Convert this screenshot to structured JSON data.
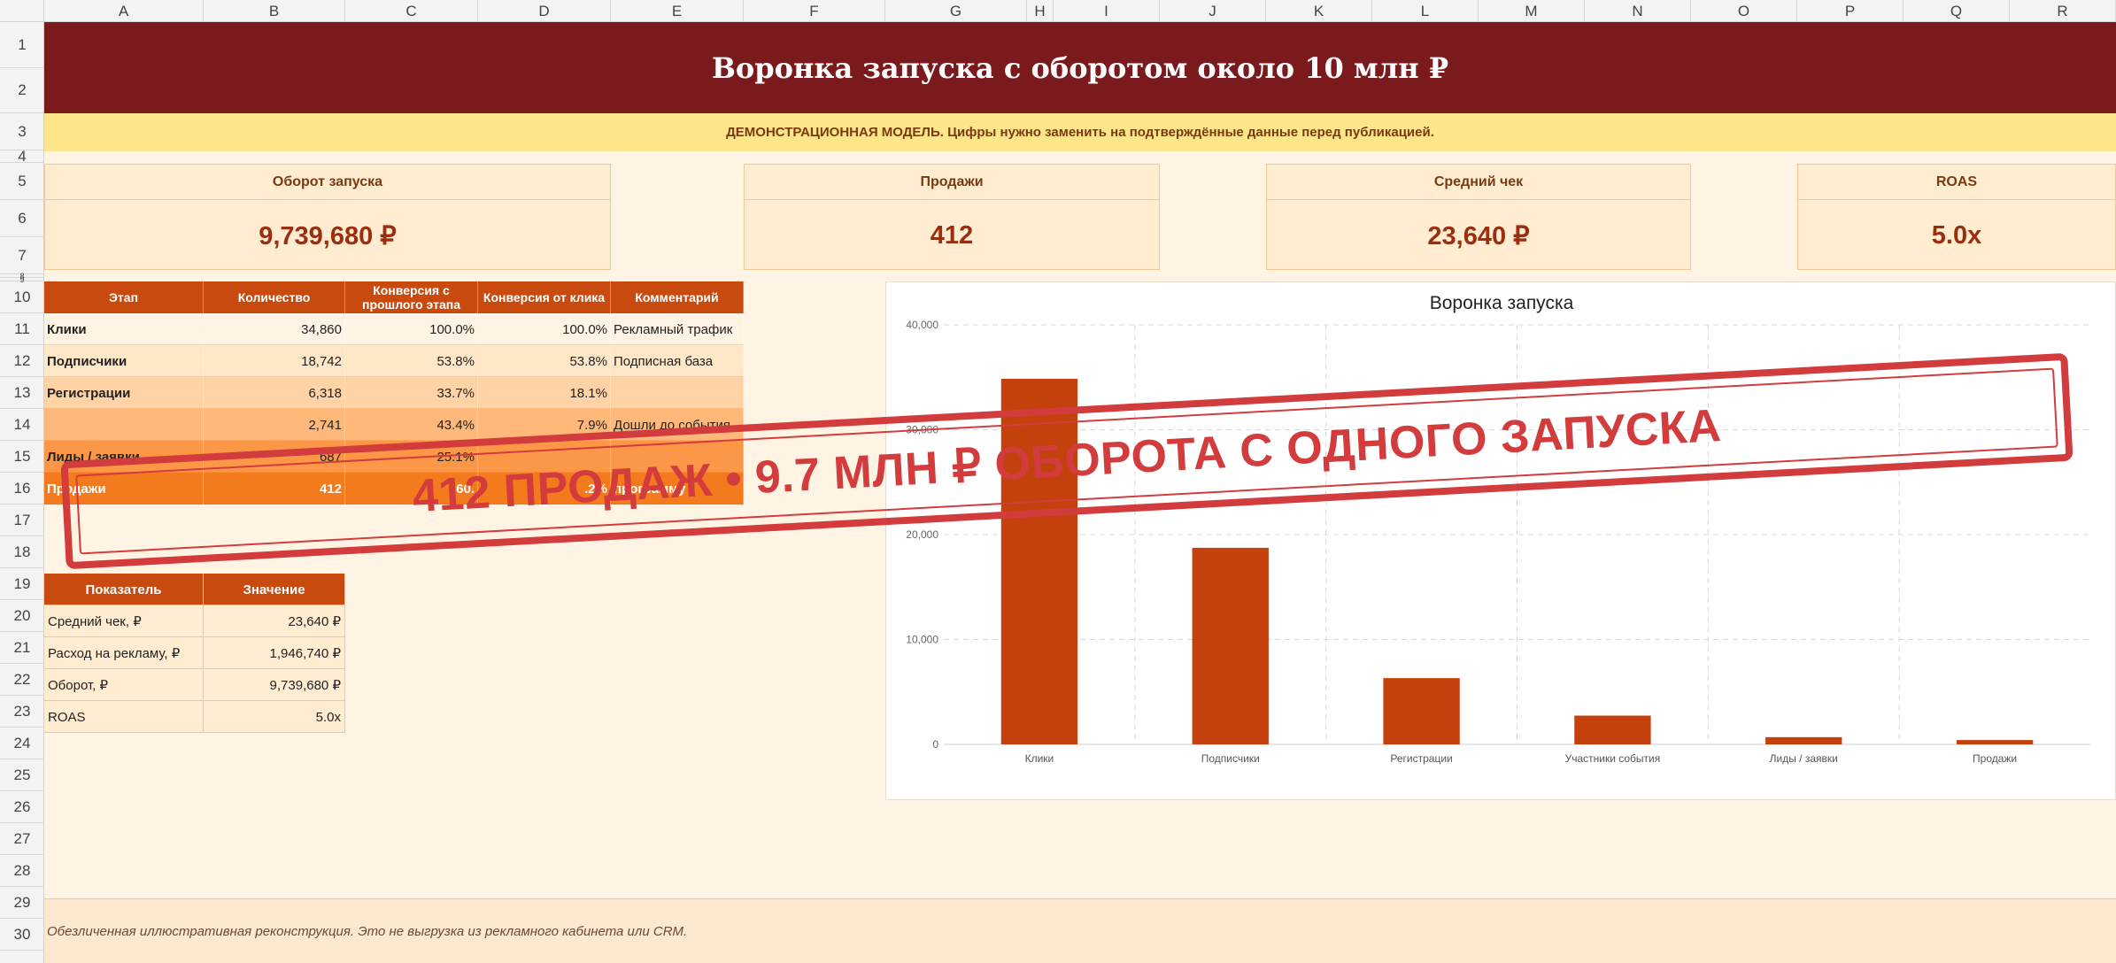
{
  "columns": [
    "A",
    "B",
    "C",
    "D",
    "E",
    "F",
    "G",
    "H",
    "I",
    "J",
    "K",
    "L",
    "M",
    "N",
    "O",
    "P",
    "Q",
    "R"
  ],
  "rows": [
    "1",
    "2",
    "3",
    "4",
    "5",
    "6",
    "7",
    "8",
    "9",
    "10",
    "11",
    "12",
    "13",
    "14",
    "15",
    "16",
    "17",
    "18",
    "19",
    "20",
    "21",
    "22",
    "23",
    "24",
    "25",
    "26",
    "27",
    "28",
    "29",
    "30"
  ],
  "title": "Воронка запуска с оборотом около 10 млн ₽",
  "notice": "ДЕМОНСТРАЦИОННАЯ МОДЕЛЬ. Цифры нужно заменить на подтверждённые данные перед публикацией.",
  "kpis": [
    {
      "label": "Оборот запуска",
      "value": "9,739,680 ₽"
    },
    {
      "label": "Продажи",
      "value": "412"
    },
    {
      "label": "Средний чек",
      "value": "23,640 ₽"
    },
    {
      "label": "ROAS",
      "value": "5.0x"
    }
  ],
  "funnel_table": {
    "headers": [
      "Этап",
      "Количество",
      "Конверсия с прошлого этапа",
      "Конверсия от клика",
      "Комментарий"
    ],
    "rows": [
      {
        "stage": "Клики",
        "count": "34,860",
        "conv_prev": "100.0%",
        "conv_click": "100.0%",
        "comment": "Рекламный трафик",
        "bg": "#fff4e4",
        "fg": "#222222"
      },
      {
        "stage": "Подписчики",
        "count": "18,742",
        "conv_prev": "53.8%",
        "conv_click": "53.8%",
        "comment": "Подписная база",
        "bg": "#ffe7c7",
        "fg": "#222222"
      },
      {
        "stage": "Регистрации",
        "count": "6,318",
        "conv_prev": "33.7%",
        "conv_click": "18.1%",
        "comment": "",
        "bg": "#ffd3a6",
        "fg": "#222222"
      },
      {
        "stage": "",
        "count": "2,741",
        "conv_prev": "43.4%",
        "conv_click": "7.9%",
        "comment": "Дошли до события",
        "bg": "#ffb87a",
        "fg": "#222222"
      },
      {
        "stage": "Лиды / заявки",
        "count": "687",
        "conv_prev": "25.1%",
        "conv_click": "",
        "comment": "",
        "bg": "#fb9746",
        "fg": "#222222"
      },
      {
        "stage": "Продажи",
        "count": "412",
        "conv_prev": "60.",
        "conv_click": ".2%",
        "comment": "программу",
        "bg": "#f47a1e",
        "fg": "#ffffff"
      }
    ]
  },
  "kv_table": {
    "headers": [
      "Показатель",
      "Значение"
    ],
    "rows": [
      {
        "label": "Средний чек, ₽",
        "value": "23,640 ₽"
      },
      {
        "label": "Расход на рекламу, ₽",
        "value": "1,946,740 ₽"
      },
      {
        "label": "Оборот, ₽",
        "value": "9,739,680 ₽"
      },
      {
        "label": "ROAS",
        "value": "5.0x"
      }
    ]
  },
  "chart_data": {
    "type": "bar",
    "title": "Воронка запуска",
    "categories": [
      "Клики",
      "Подписчики",
      "Регистрации",
      "Участники события",
      "Лиды / заявки",
      "Продажи"
    ],
    "values": [
      34860,
      18742,
      6318,
      2741,
      687,
      412
    ],
    "ylim": [
      0,
      40000
    ],
    "yticks": [
      0,
      10000,
      20000,
      30000,
      40000
    ],
    "ytick_labels": [
      "0",
      "10,000",
      "20,000",
      "30,000",
      "40,000"
    ],
    "xlabel": "",
    "ylabel": "",
    "grid": true,
    "bar_color": "#c4400c",
    "grid_color": "#d8d8d8"
  },
  "stamp": "412 ПРОДАЖ • 9.7 МЛН ₽ ОБОРОТА С ОДНОГО ЗАПУСКА",
  "footer": "Обезличенная иллюстративная реконструкция. Это не выгрузка из рекламного кабинета или CRM.",
  "colors": {
    "title_band": "#7a1a1c",
    "notice_band": "#fde58a",
    "sheet_bg": "#fff4e4",
    "header_orange": "#c94a0f",
    "stamp_red": "#d23c3c"
  }
}
